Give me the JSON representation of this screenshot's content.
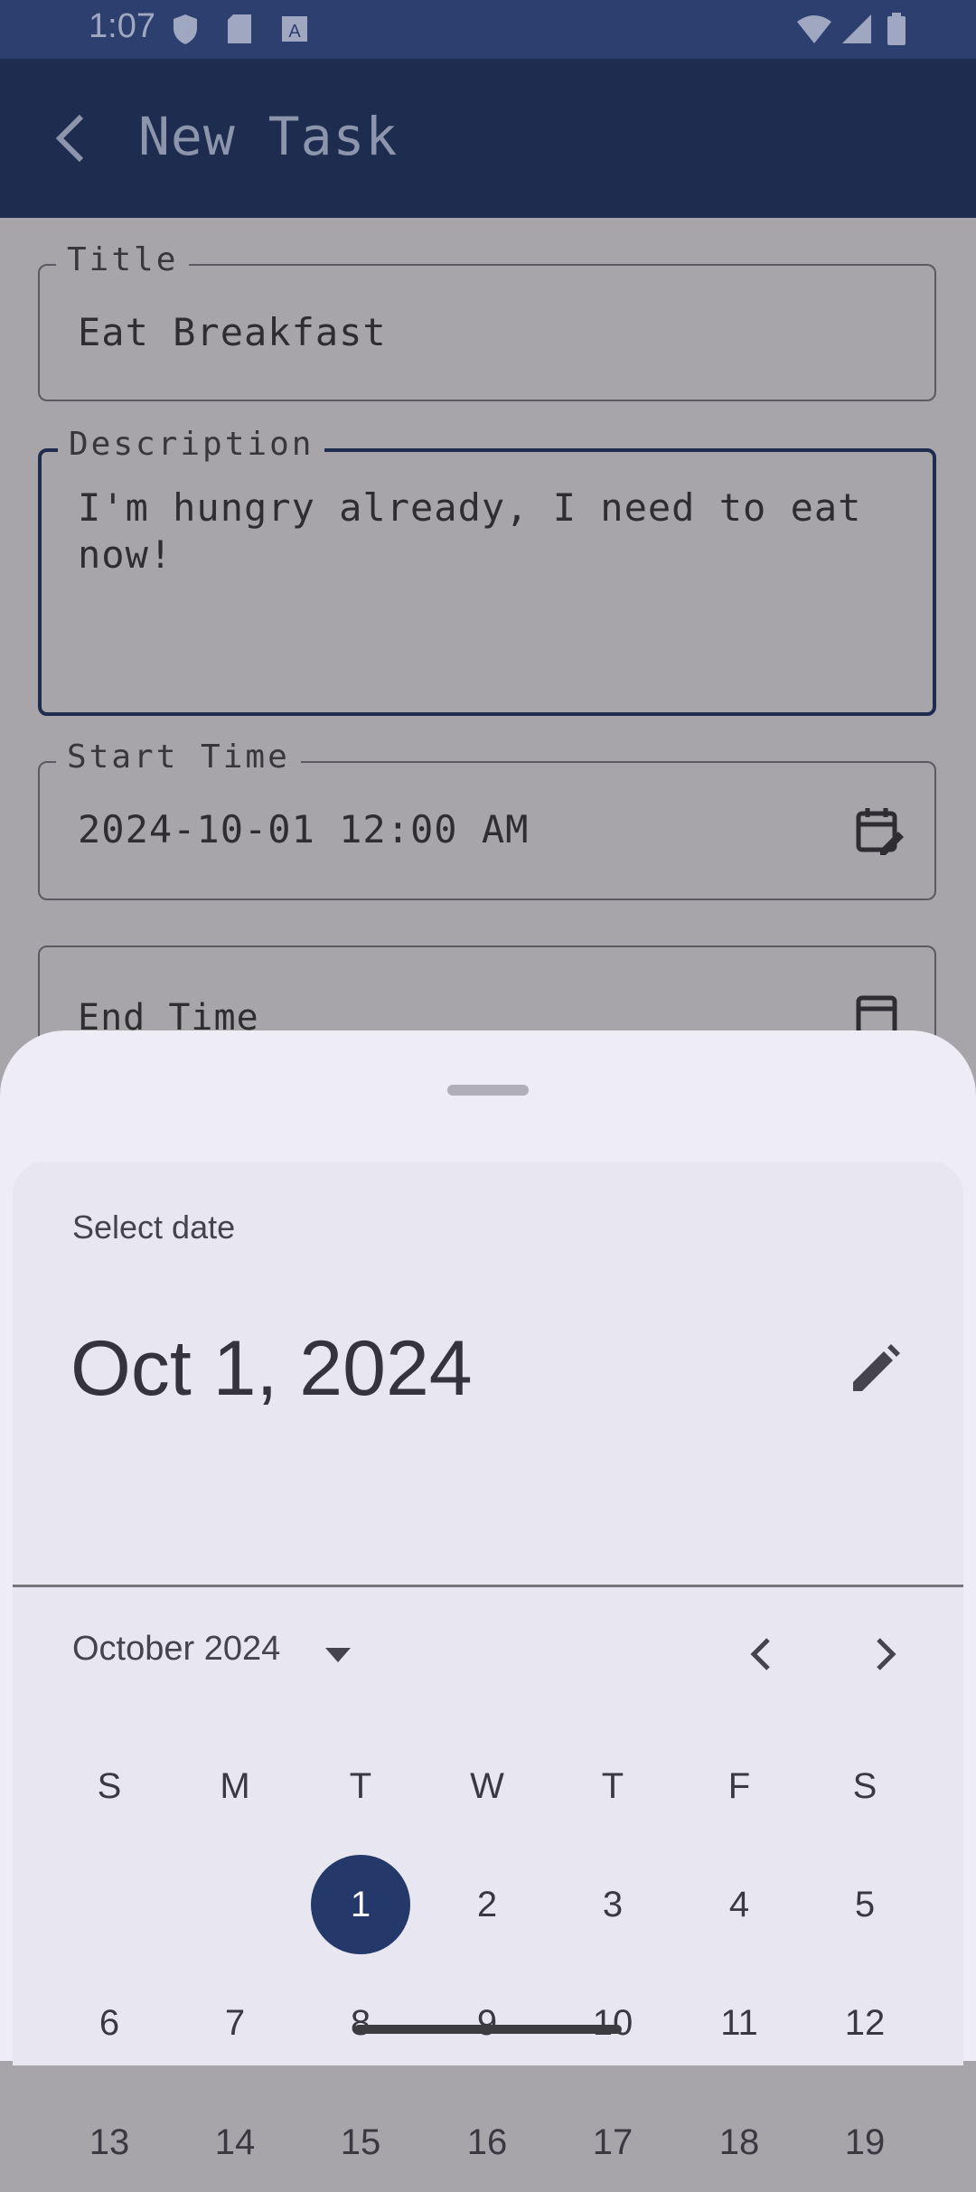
{
  "status_bar": {
    "time": "1:07"
  },
  "app_bar": {
    "title": "New Task"
  },
  "form": {
    "title": {
      "label": "Title",
      "value": "Eat Breakfast"
    },
    "description": {
      "label": "Description",
      "value": "I'm hungry already, I need to eat now!",
      "line1": "I'm hungry already, I need to eat",
      "line2": "now!"
    },
    "start_time": {
      "label": "Start Time",
      "value": "2024-10-01 12:00 AM"
    },
    "end_time": {
      "label": "End Time",
      "value": ""
    }
  },
  "date_picker": {
    "heading": "Select date",
    "selected_date": "Oct 1, 2024",
    "month_label": "October 2024",
    "weekdays": [
      "S",
      "M",
      "T",
      "W",
      "T",
      "F",
      "S"
    ],
    "week1": [
      "",
      "",
      "1",
      "2",
      "3",
      "4",
      "5"
    ],
    "week2": [
      "6",
      "7",
      "8",
      "9",
      "10",
      "11",
      "12"
    ],
    "week3": [
      "13",
      "14",
      "15",
      "16",
      "17",
      "18",
      "19"
    ],
    "selected_day": "1"
  },
  "colors": {
    "primary": "#1d2c4f",
    "selected": "#24396a",
    "sheet": "#eeedf6"
  }
}
